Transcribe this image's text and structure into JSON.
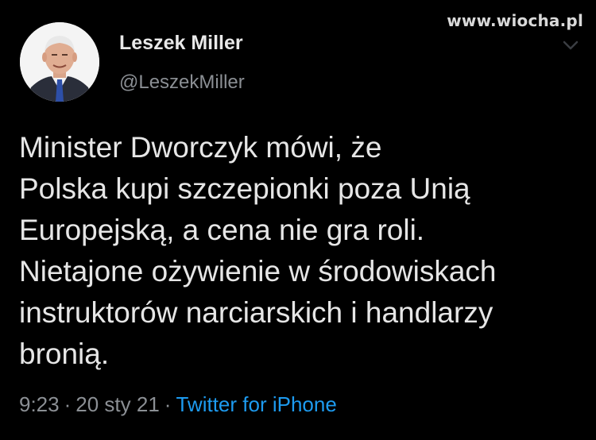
{
  "watermark": "www.wiocha.pl",
  "author": {
    "display_name": "Leszek Miller",
    "handle": "@LeszekMiller"
  },
  "tweet": {
    "text": "Minister Dworczyk mówi, że\nPolska kupi szczepionki poza Unią\nEuropejską, a cena nie gra roli.\nNietajone ożywienie w środowiskach\ninstruktorów narciarskich i handlarzy\nbronią.",
    "time": "9:23",
    "date": "20 sty 21",
    "source": "Twitter for iPhone"
  },
  "colors": {
    "background": "#000000",
    "text": "#e6e6e6",
    "muted": "#8b8f94",
    "link": "#1d9bf0"
  },
  "icons": {
    "menu": "chevron-down-icon"
  }
}
